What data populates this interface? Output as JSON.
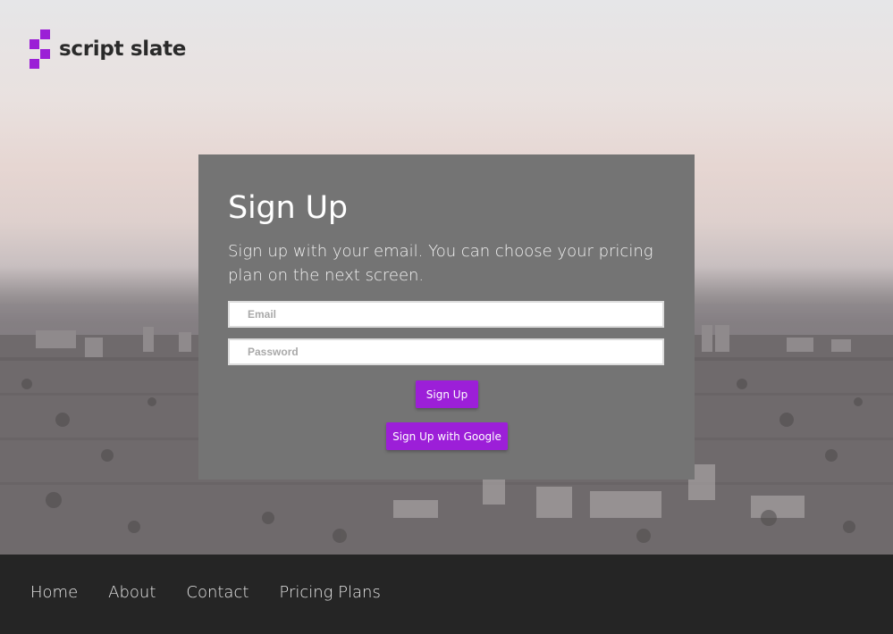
{
  "brand": {
    "name": "script slate",
    "accent_color": "#9b1fd6"
  },
  "signup": {
    "title": "Sign Up",
    "description": "Sign up with your email. You can choose your pricing plan on the next screen.",
    "email_placeholder": "Email",
    "password_placeholder": "Password",
    "signup_button": "Sign Up",
    "google_button": "Sign Up with Google"
  },
  "footer": {
    "links": [
      "Home",
      "About",
      "Contact",
      "Pricing Plans"
    ]
  }
}
